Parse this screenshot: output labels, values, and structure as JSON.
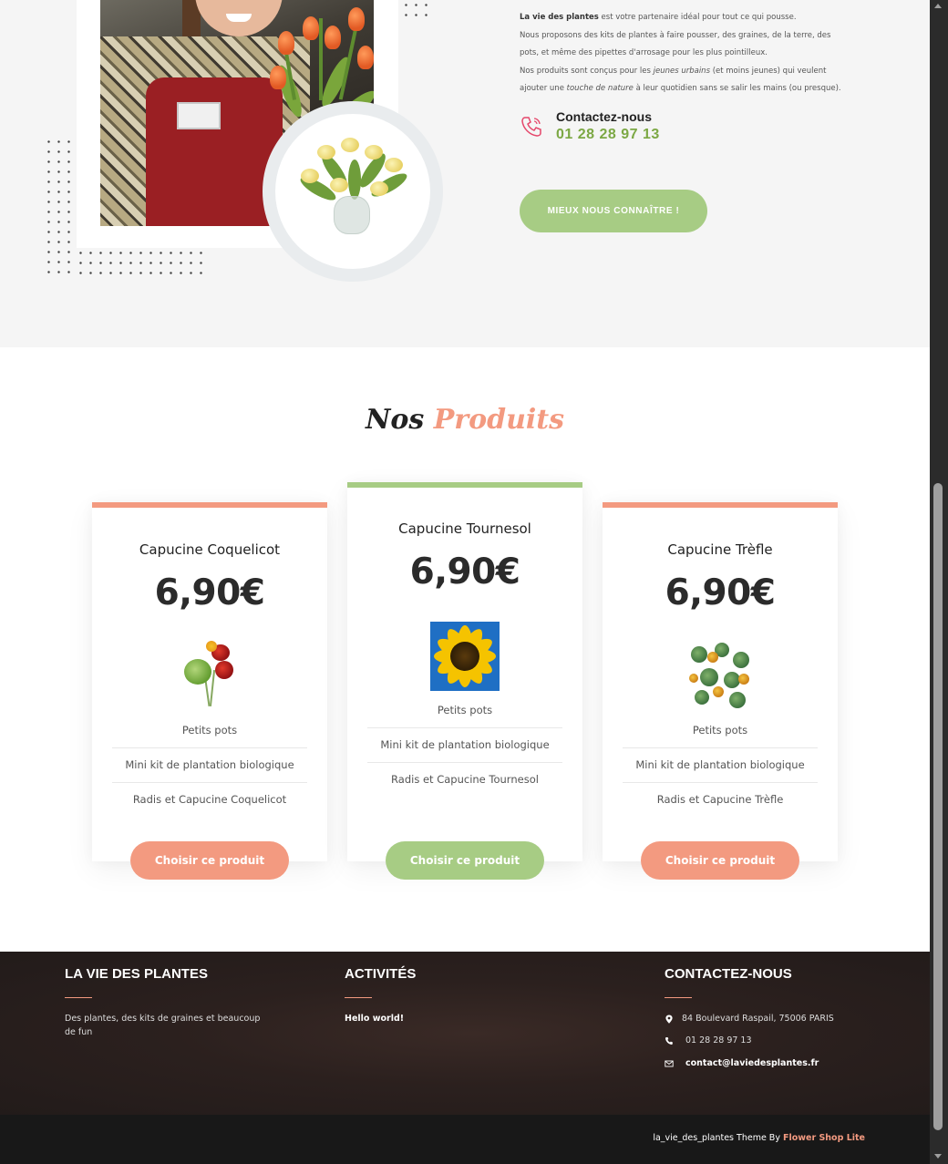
{
  "about": {
    "brand": "La vie des plantes",
    "line1_rest": " est votre partenaire idéal pour tout ce qui pousse.",
    "line2": "Nous proposons des kits de plantes à faire pousser, des graines, de la terre, des",
    "line3": "pots, et même des pipettes d'arrosage pour les plus pointilleux.",
    "line4_a": "Nos produits sont conçus pour les ",
    "line4_em": "jeunes urbains",
    "line4_b": " (et moins jeunes) qui veulent",
    "line5_a": "ajouter une ",
    "line5_em": "touche de nature",
    "line5_b": " à leur quotidien sans se salir les mains (ou presque).",
    "contact_label": "Contactez-nous",
    "contact_phone": "01 28 28 97 13",
    "cta_label": "MIEUX NOUS CONNAÎTRE !"
  },
  "products": {
    "title_part1": "Nos",
    "title_part2": "Produits",
    "items": [
      {
        "name": "Capucine Coquelicot",
        "price": "6,90€",
        "features": [
          "Petits pots",
          "Mini kit de plantation biologique",
          "Radis et Capucine Coquelicot"
        ],
        "button": "Choisir ce produit",
        "accent": "#f39a80"
      },
      {
        "name": "Capucine Tournesol",
        "price": "6,90€",
        "features": [
          "Petits pots",
          "Mini kit de plantation biologique",
          "Radis et Capucine Tournesol"
        ],
        "button": "Choisir ce produit",
        "accent": "#a7cc84"
      },
      {
        "name": "Capucine Trèfle",
        "price": "6,90€",
        "features": [
          "Petits pots",
          "Mini kit de plantation biologique",
          "Radis et Capucine Trèfle"
        ],
        "button": "Choisir ce produit",
        "accent": "#f39a80"
      }
    ]
  },
  "footer": {
    "col1_title": "LA VIE DES PLANTES",
    "col1_text_1": "Des plantes, des kits de graines et beaucoup",
    "col1_text_2": "de fun",
    "col2_title": "ACTIVITÉS",
    "col2_link": "Hello world!",
    "col3_title": "CONTACTEZ-NOUS",
    "address": "84 Boulevard Raspail, 75006 PARIS",
    "phone": "01 28 28 97 13",
    "email": "contact@laviedesplantes.fr",
    "icons": [
      "map-pin-icon",
      "phone-icon",
      "mail-icon"
    ]
  },
  "credits": {
    "prefix": "la_vie_des_plantes Theme By ",
    "link": "Flower Shop Lite"
  },
  "colors": {
    "salmon": "#f39a80",
    "green": "#a7cc84",
    "dark_green_text": "#7ca844"
  }
}
